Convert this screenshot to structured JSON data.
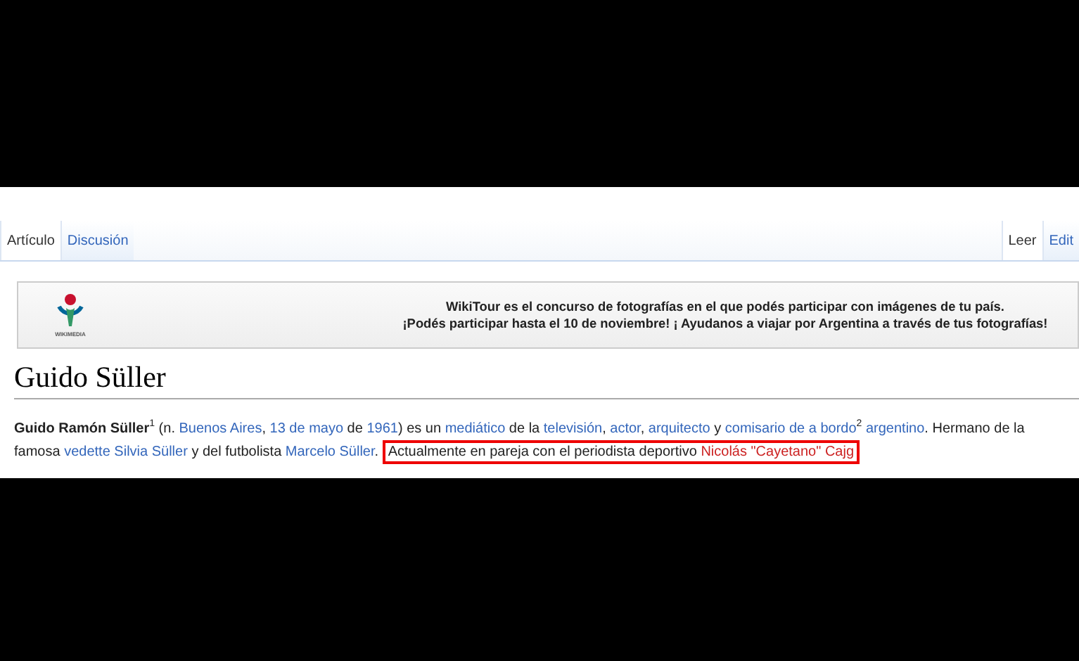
{
  "tabs_left": [
    {
      "label": "Artículo",
      "selected": true
    },
    {
      "label": "Discusión",
      "selected": false
    }
  ],
  "tabs_right": [
    {
      "label": "Leer",
      "selected": true
    },
    {
      "label": "Edit",
      "selected": false
    }
  ],
  "banner": {
    "logo_text": "WIKIMEDIA",
    "lines": [
      "WikiTour es el concurso de fotografías en el que podés participar con imágenes de tu país.",
      "¡Podés participar hasta el 10 de noviembre! ¡ Ayudanos a viajar por Argentina a través de tus fotografías!"
    ]
  },
  "title": "Guido Süller",
  "paragraph": [
    [
      {
        "kind": "bold",
        "text": "Guido Ramón Süller"
      },
      {
        "kind": "sup",
        "text": "1"
      },
      {
        "kind": "text",
        "text": " (n. "
      },
      {
        "kind": "link",
        "text": "Buenos Aires"
      },
      {
        "kind": "text",
        "text": ", "
      },
      {
        "kind": "link",
        "text": "13 de mayo"
      },
      {
        "kind": "text",
        "text": " de "
      },
      {
        "kind": "link",
        "text": "1961"
      },
      {
        "kind": "text",
        "text": ") es un "
      },
      {
        "kind": "link",
        "text": "mediático"
      },
      {
        "kind": "text",
        "text": " de la "
      },
      {
        "kind": "link",
        "text": "televisión"
      },
      {
        "kind": "text",
        "text": ", "
      },
      {
        "kind": "link",
        "text": "actor"
      },
      {
        "kind": "text",
        "text": ", "
      },
      {
        "kind": "link",
        "text": "arquitecto"
      },
      {
        "kind": "text",
        "text": " y "
      },
      {
        "kind": "link",
        "text": "comisario de a bordo"
      },
      {
        "kind": "sup",
        "text": "2"
      },
      {
        "kind": "space"
      },
      {
        "kind": "link",
        "text": "argentino"
      },
      {
        "kind": "text",
        "text": ". Hermano de la"
      }
    ],
    [
      {
        "kind": "text",
        "text": "famosa "
      },
      {
        "kind": "link",
        "text": "vedette"
      },
      {
        "kind": "space"
      },
      {
        "kind": "link",
        "text": "Silvia Süller"
      },
      {
        "kind": "text",
        "text": " y del futbolista "
      },
      {
        "kind": "link",
        "text": "Marcelo Süller"
      },
      {
        "kind": "text",
        "text": ". "
      },
      {
        "kind": "highlight",
        "parts": [
          {
            "kind": "text",
            "text": "Actualmente en pareja con el periodista deportivo "
          },
          {
            "kind": "redlink",
            "text": "Nicolás \"Cayetano\" Cajg"
          }
        ]
      }
    ]
  ]
}
